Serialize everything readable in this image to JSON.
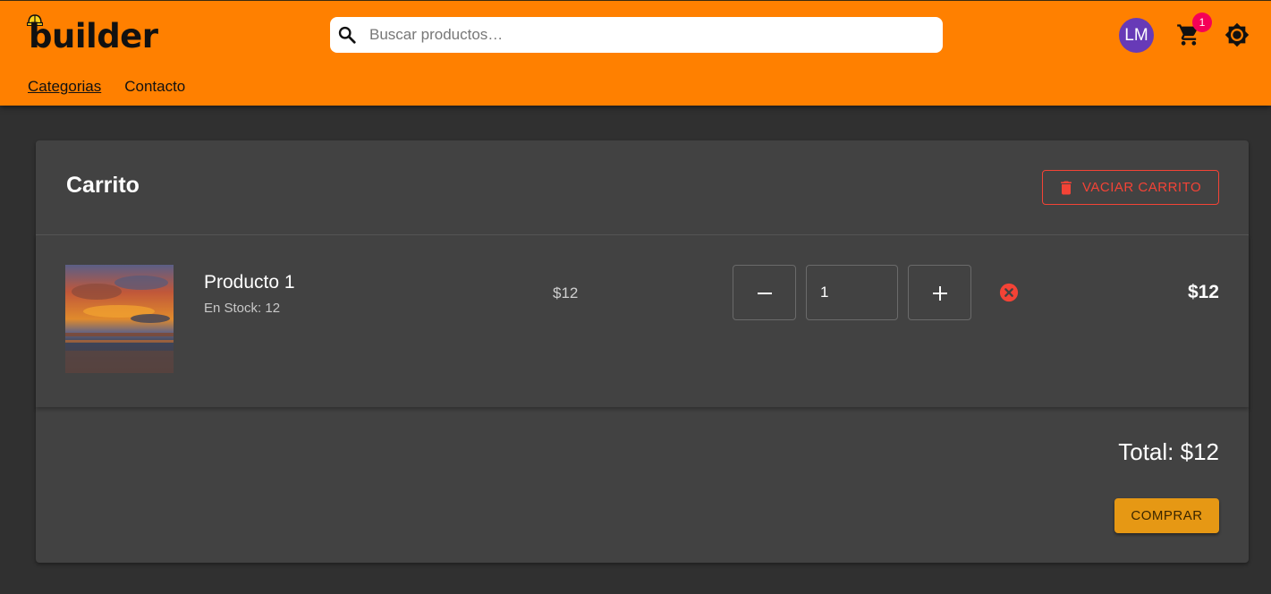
{
  "header": {
    "logo_text": "builder",
    "search_placeholder": "Buscar productos…",
    "avatar_initials": "LM",
    "cart_count": "1",
    "nav": [
      {
        "label": "Categorias"
      },
      {
        "label": "Contacto"
      }
    ],
    "icons": [
      "helmet-icon",
      "search-icon",
      "shopping-cart-icon",
      "brightness-icon"
    ]
  },
  "cart": {
    "title": "Carrito",
    "empty_label": "VACIAR CARRITO",
    "items": [
      {
        "name": "Producto 1",
        "stock": "En Stock: 12",
        "unit_price": "$12",
        "quantity": "1",
        "line_total": "$12"
      }
    ],
    "total": "Total: $12",
    "buy_label": "COMPRAR"
  },
  "colors": {
    "primary": "#ff8000",
    "background": "#303030",
    "card": "#424242",
    "danger": "#f44336",
    "buy": "#e69814",
    "avatar": "#673ab7",
    "badge": "#f50057"
  }
}
